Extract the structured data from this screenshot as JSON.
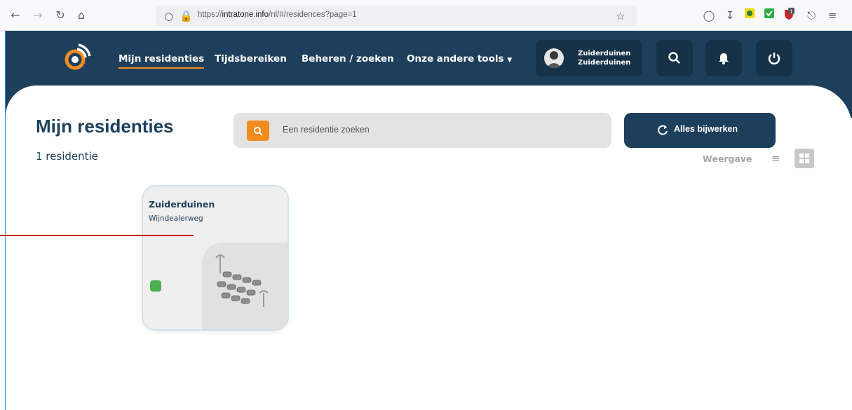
{
  "browser": {
    "url_prefix": "https://",
    "url_host": "intratone.info",
    "url_path": "/nl/#/residences?page=1",
    "notification_count": "1"
  },
  "nav": {
    "items": [
      {
        "label": "Mijn residenties",
        "active": true
      },
      {
        "label": "Tijdsbereiken",
        "active": false
      },
      {
        "label": "Beheren / zoeken",
        "active": false
      },
      {
        "label": "Onze andere tools",
        "active": false
      }
    ],
    "user_line1": "Zuiderduinen",
    "user_line2": "Zuiderduinen"
  },
  "page": {
    "title": "Mijn residenties",
    "count": "1 residentie",
    "search_placeholder": "Een residentie zoeken",
    "update_label": "Alles bijwerken",
    "view_label": "Weergave"
  },
  "residences": [
    {
      "name": "Zuiderduinen",
      "street": "Wijndealerweg",
      "status": "online"
    }
  ],
  "colors": {
    "brand_navy": "#1d3f5c",
    "accent_orange": "#f28c1e",
    "status_green": "#4caf50"
  }
}
